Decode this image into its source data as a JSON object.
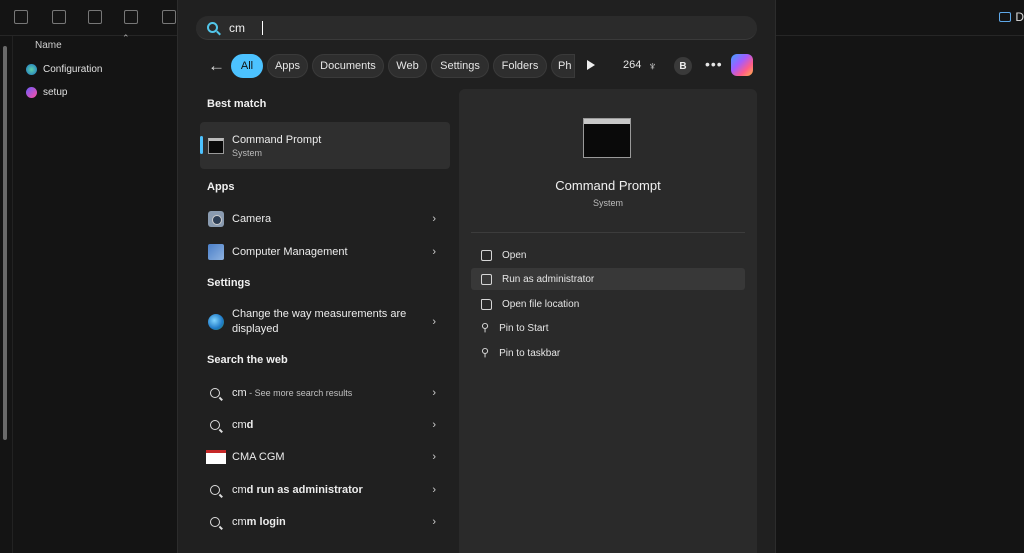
{
  "explorer": {
    "column_header": "Name",
    "files": [
      {
        "name": "Configuration",
        "icon": "edge-icon"
      },
      {
        "name": "setup",
        "icon": "media-icon"
      }
    ],
    "right_button_label": "D"
  },
  "search": {
    "query": "cm"
  },
  "filters": {
    "chips": [
      "All",
      "Apps",
      "Documents",
      "Web",
      "Settings",
      "Folders",
      "Ph"
    ],
    "active": "All",
    "points": "264",
    "avatar_initial": "B",
    "more": "•••"
  },
  "results": {
    "best_match_title": "Best match",
    "best_match": {
      "name": "Command Prompt",
      "type": "System"
    },
    "apps_title": "Apps",
    "apps": [
      {
        "name": "Camera"
      },
      {
        "name": "Computer Management"
      }
    ],
    "settings_title": "Settings",
    "settings": [
      {
        "line1": "Change the way measurements are",
        "line2": "displayed"
      }
    ],
    "web_title": "Search the web",
    "web": [
      {
        "prefix": "cm",
        "suffix": " - See more search results"
      },
      {
        "prefix": "cm",
        "bold": "d"
      },
      {
        "prefix": "CMA CGM",
        "bold": ""
      },
      {
        "prefix": "cm",
        "bold": "d run as administrator"
      },
      {
        "prefix": "cm",
        "bold": "m login"
      }
    ]
  },
  "details": {
    "title": "Command Prompt",
    "subtitle": "System",
    "actions": [
      {
        "label": "Open",
        "icon": "open-external-icon"
      },
      {
        "label": "Run as administrator",
        "icon": "shield-admin-icon"
      },
      {
        "label": "Open file location",
        "icon": "folder-icon"
      },
      {
        "label": "Pin to Start",
        "icon": "pin-icon"
      },
      {
        "label": "Pin to taskbar",
        "icon": "pin-icon"
      }
    ]
  },
  "colors": {
    "accent": "#4cc2ff",
    "panel": "#202020",
    "details_bg": "#2a2a2a"
  }
}
